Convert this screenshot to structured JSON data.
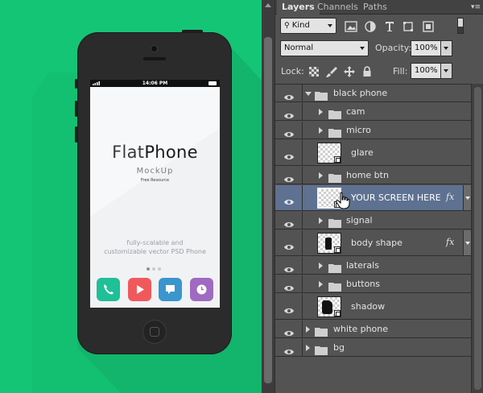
{
  "mockup": {
    "status_time": "14:06 PM",
    "title_light": "Flat",
    "title_bold": "Phone",
    "subtitle": "MockUp",
    "free_resource": "Free Resource",
    "description_line1": "fully-scalable and",
    "description_line2": "customizable vector PSD Phone",
    "apps": [
      {
        "name": "phone",
        "color": "#1fbf97",
        "icon": "phone-icon"
      },
      {
        "name": "video",
        "color": "#f0595c",
        "icon": "play-icon"
      },
      {
        "name": "messages",
        "color": "#3a96cc",
        "icon": "chat-icon"
      },
      {
        "name": "clock",
        "color": "#9f6ac0",
        "icon": "clock-icon"
      }
    ],
    "background_color": "#15c576"
  },
  "panel": {
    "tabs": [
      "Layers",
      "Channels",
      "Paths"
    ],
    "active_tab": "Layers",
    "filter_kind": "Kind",
    "blend_mode": "Normal",
    "opacity_label": "Opacity:",
    "opacity_value": "100%",
    "lock_label": "Lock:",
    "fill_label": "Fill:",
    "fill_value": "100%",
    "selection_color": "#5e7191"
  },
  "layers": [
    {
      "name": "black phone",
      "type": "group",
      "expanded": true,
      "indent": 0
    },
    {
      "name": "cam",
      "type": "group",
      "expanded": false,
      "indent": 1
    },
    {
      "name": "micro",
      "type": "group",
      "expanded": false,
      "indent": 1
    },
    {
      "name": "glare",
      "type": "smart-object",
      "indent": 1
    },
    {
      "name": "home btn",
      "type": "group",
      "expanded": false,
      "indent": 1
    },
    {
      "name": "YOUR SCREEN HERE",
      "type": "smart-object",
      "indent": 1,
      "selected": true,
      "fx": "fx"
    },
    {
      "name": "signal",
      "type": "group",
      "expanded": false,
      "indent": 1
    },
    {
      "name": "body shape",
      "type": "smart-object",
      "indent": 1,
      "fx": "fx"
    },
    {
      "name": "laterals",
      "type": "group",
      "expanded": false,
      "indent": 1
    },
    {
      "name": "buttons",
      "type": "group",
      "expanded": false,
      "indent": 1
    },
    {
      "name": "shadow",
      "type": "smart-object",
      "indent": 1
    },
    {
      "name": "white phone",
      "type": "group",
      "expanded": false,
      "indent": 0
    },
    {
      "name": "bg",
      "type": "group",
      "expanded": false,
      "indent": 0
    }
  ]
}
